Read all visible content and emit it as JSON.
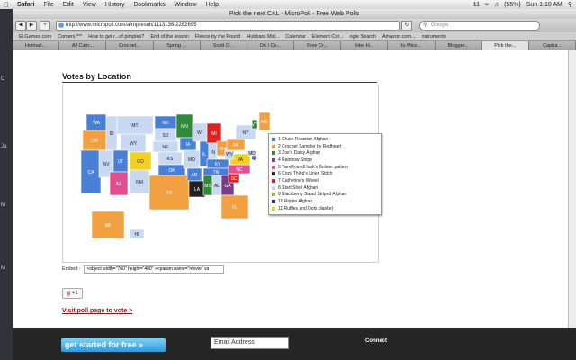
{
  "menubar": {
    "items": [
      "Safari",
      "File",
      "Edit",
      "View",
      "History",
      "Bookmarks",
      "Window",
      "Help"
    ],
    "status_battery": "(55%)",
    "status_clock": "Sun 1:10 AM",
    "status_input": "11"
  },
  "window": {
    "title": "Pick the next CAL - MicroPoll - Free Web Polls"
  },
  "toolbar": {
    "url": "http://www.micropoll.com/a/mpresult/1113136-2282695",
    "search_placeholder": "Google"
  },
  "bookmarks": [
    "El.Games.com",
    "Comers ***",
    "How to get r...of pimples?",
    "End of the lesson",
    "Fleece by the Pound",
    "Hubbard Mid...",
    "Calendar",
    "Element Cor...",
    "ogle Search",
    "Amazon.com...",
    "nstruments"
  ],
  "tabs": [
    "Hotmail...",
    "All Cam...",
    "Crochet...",
    "Spring ...",
    "Scott O...",
    "Do I Ce...",
    "Free Cr...",
    "Inter H...",
    "to Mixx...",
    "Blogger...",
    "Pick the...",
    "Captur..."
  ],
  "active_tab_index": 10,
  "page": {
    "heading": "Votes by Location",
    "embed_label": "Embed :",
    "embed_code": "<object width=\"700\" height=\"400\" ><param name=\"movie\" va",
    "gplus_label": "+1",
    "visit_link": "Visit poll page to vote >"
  },
  "legend": [
    {
      "label": "1 Chain Reaction Afghan",
      "color": "#4a7fd6"
    },
    {
      "label": "2 Crochet Sampler by Redheart",
      "color": "#f0a040"
    },
    {
      "label": "3 Zoe's Daisy Afghan",
      "color": "#2e8b3a"
    },
    {
      "label": "4 Rainbow Stripe",
      "color": "#7a3c8a"
    },
    {
      "label": "5 YarnRoundHook's Bolster pattern",
      "color": "#e05090"
    },
    {
      "label": "6 Cozy Thing's Linen Stitch",
      "color": "#222222"
    },
    {
      "label": "7 Catherine's Wheel",
      "color": "#e02020"
    },
    {
      "label": "8 Start Shell Afghan",
      "color": "#c8d8f0"
    },
    {
      "label": "9 Blackberry Salad Striped Afghan",
      "color": "#a0c040"
    },
    {
      "label": "10 Ripple Afghan",
      "color": "#1f2f7a"
    },
    {
      "label": "11 Ruffles and Dots blanket",
      "color": "#f0d020"
    }
  ],
  "states": [
    {
      "abbr": "WA"
    },
    {
      "abbr": "OR"
    },
    {
      "abbr": "CA"
    },
    {
      "abbr": "ID"
    },
    {
      "abbr": "NV"
    },
    {
      "abbr": "MT"
    },
    {
      "abbr": "WY"
    },
    {
      "abbr": "UT"
    },
    {
      "abbr": "AZ"
    },
    {
      "abbr": "CO"
    },
    {
      "abbr": "NM"
    },
    {
      "abbr": "ND"
    },
    {
      "abbr": "SD"
    },
    {
      "abbr": "NE"
    },
    {
      "abbr": "KS"
    },
    {
      "abbr": "OK"
    },
    {
      "abbr": "TX"
    },
    {
      "abbr": "MN"
    },
    {
      "abbr": "IA"
    },
    {
      "abbr": "MO"
    },
    {
      "abbr": "AR"
    },
    {
      "abbr": "LA"
    },
    {
      "abbr": "WI"
    },
    {
      "abbr": "IL"
    },
    {
      "abbr": "MI"
    },
    {
      "abbr": "IN"
    },
    {
      "abbr": "OH"
    },
    {
      "abbr": "KY"
    },
    {
      "abbr": "TN"
    },
    {
      "abbr": "MS"
    },
    {
      "abbr": "AL"
    },
    {
      "abbr": "GA"
    },
    {
      "abbr": "FL"
    },
    {
      "abbr": "SC"
    },
    {
      "abbr": "NC"
    },
    {
      "abbr": "VA"
    },
    {
      "abbr": "WV"
    },
    {
      "abbr": "PA"
    },
    {
      "abbr": "NY"
    },
    {
      "abbr": "ME"
    },
    {
      "abbr": "VT"
    },
    {
      "abbr": "AK"
    },
    {
      "abbr": "HI"
    },
    {
      "abbr": "MD"
    },
    {
      "abbr": "DC"
    }
  ],
  "footer": {
    "get_started": "get started for free »",
    "email_placeholder": "Email Address",
    "connect_label": "Connect"
  }
}
